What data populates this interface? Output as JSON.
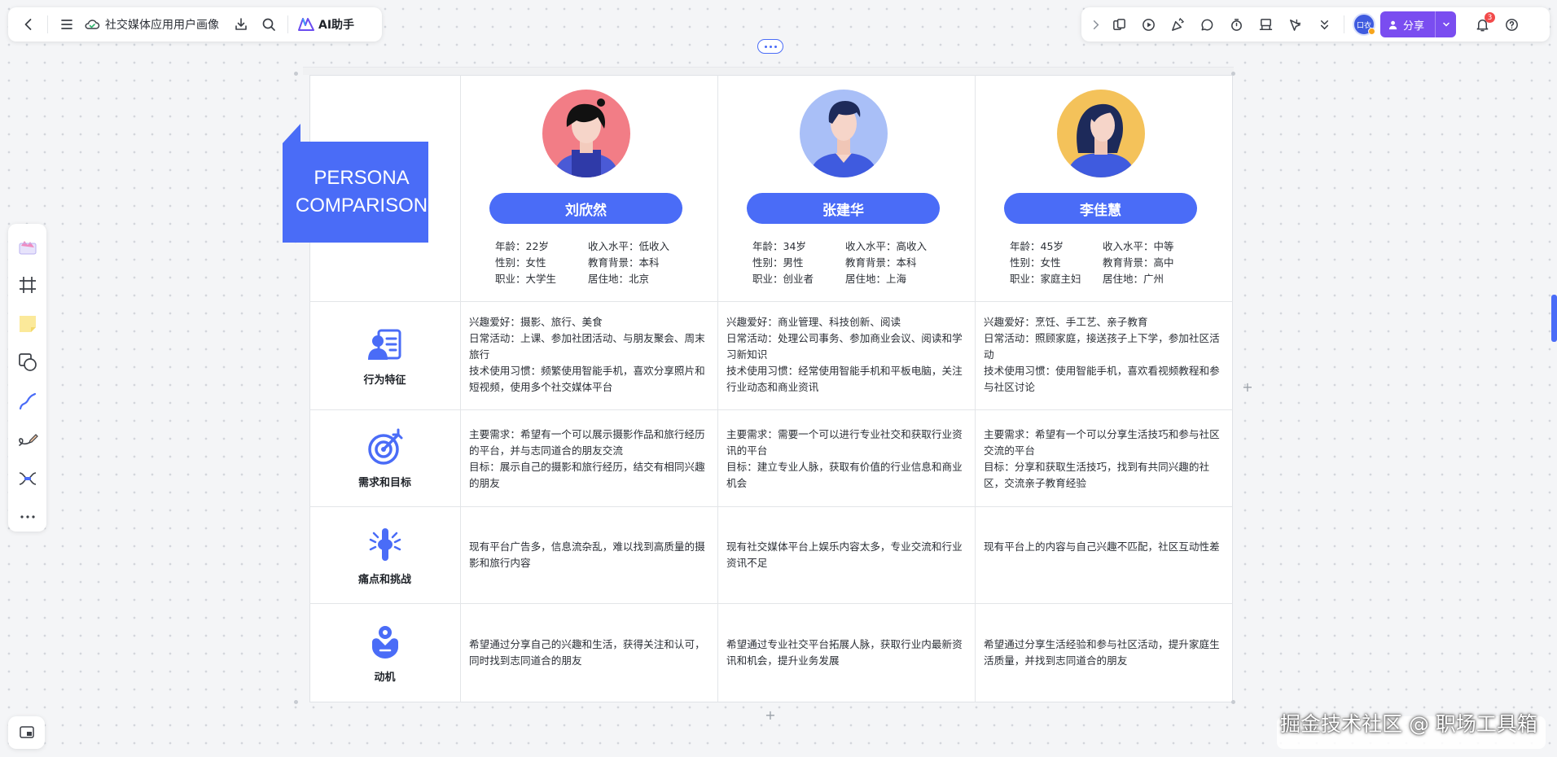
{
  "toolbar": {
    "doc_title": "社交媒体应用用户画像",
    "ai_label": "AI助手",
    "user_initials": "口衣",
    "share_label": "分享",
    "notification_count": "3"
  },
  "board": {
    "title_line1": "PERSONA",
    "title_line2": "COMPARISON"
  },
  "personas": [
    {
      "name": "刘欣然",
      "age": "年龄：22岁",
      "income": "收入水平：低收入",
      "gender": "性别：女性",
      "education": "教育背景：本科",
      "job": "职业：大学生",
      "city": "居住地：北京"
    },
    {
      "name": "张建华",
      "age": "年龄：34岁",
      "income": "收入水平：高收入",
      "gender": "性别：男性",
      "education": "教育背景：本科",
      "job": "职业：创业者",
      "city": "居住地：上海"
    },
    {
      "name": "李佳慧",
      "age": "年龄：45岁",
      "income": "收入水平：中等",
      "gender": "性别：女性",
      "education": "教育背景：高中",
      "job": "职业：家庭主妇",
      "city": "居住地：广州"
    }
  ],
  "rows": {
    "behavior": {
      "label": "行为特征",
      "cells": [
        [
          "兴趣爱好：摄影、旅行、美食",
          "日常活动：上课、参加社团活动、与朋友聚会、周末旅行",
          "技术使用习惯：频繁使用智能手机，喜欢分享照片和短视频，使用多个社交媒体平台"
        ],
        [
          "兴趣爱好：商业管理、科技创新、阅读",
          "日常活动：处理公司事务、参加商业会议、阅读和学习新知识",
          "技术使用习惯：经常使用智能手机和平板电脑，关注行业动态和商业资讯"
        ],
        [
          "兴趣爱好：烹饪、手工艺、亲子教育",
          "日常活动：照顾家庭，接送孩子上下学，参加社区活动",
          "技术使用习惯：使用智能手机，喜欢看视频教程和参与社区讨论"
        ]
      ]
    },
    "needs": {
      "label": "需求和目标",
      "cells": [
        [
          "主要需求：希望有一个可以展示摄影作品和旅行经历的平台，并与志同道合的朋友交流",
          "目标：展示自己的摄影和旅行经历，结交有相同兴趣的朋友"
        ],
        [
          "主要需求：需要一个可以进行专业社交和获取行业资讯的平台",
          "目标：建立专业人脉，获取有价值的行业信息和商业机会"
        ],
        [
          "主要需求：希望有一个可以分享生活技巧和参与社区交流的平台",
          "目标：分享和获取生活技巧，找到有共同兴趣的社区，交流亲子教育经验"
        ]
      ]
    },
    "pain": {
      "label": "痛点和挑战",
      "cells": [
        [
          "现有平台广告多，信息流杂乱，难以找到高质量的摄影和旅行内容"
        ],
        [
          "现有社交媒体平台上娱乐内容太多，专业交流和行业资讯不足"
        ],
        [
          "现有平台上的内容与自己兴趣不匹配，社区互动性差"
        ]
      ]
    },
    "motivation": {
      "label": "动机",
      "cells": [
        [
          "希望通过分享自己的兴趣和生活，获得关注和认可，同时找到志同道合的朋友"
        ],
        [
          "希望通过专业社交平台拓展人脉，获取行业内最新资讯和机会，提升业务发展"
        ],
        [
          "希望通过分享生活经验和参与社区活动，提升家庭生活质量，并找到志同道合的朋友"
        ]
      ]
    }
  },
  "watermark": "掘金技术社区 @ 职场工具箱",
  "colors": {
    "accent": "#4a6cf7",
    "share": "#7a4df0"
  }
}
